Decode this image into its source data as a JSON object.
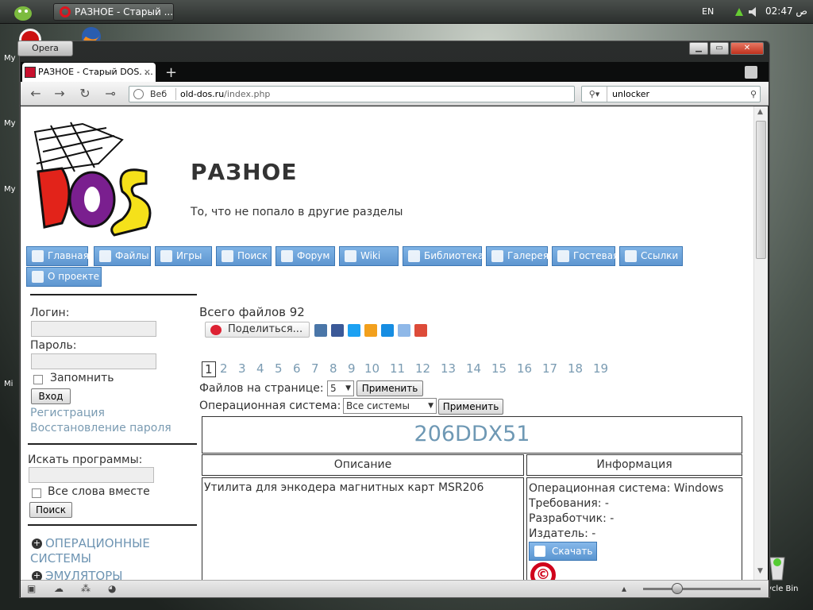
{
  "taskbar": {
    "task_title": "РАЗНОЕ - Старый ...",
    "lang": "EN",
    "time": "02:47",
    "ampm": "ص"
  },
  "desktop": {
    "labels": [
      "My",
      "My",
      "My",
      "Mi"
    ],
    "recycle": "ycle Bin"
  },
  "opera": {
    "menu_label": "Opera",
    "tab_title": "РАЗНОЕ - Старый DOS. ...",
    "tab_close": "×",
    "new_tab": "+",
    "url_prefix": "Веб",
    "url_domain": "old-dos.ru",
    "url_path": "/index.php",
    "search_text": "unlocker"
  },
  "site": {
    "title": "РАЗНОЕ",
    "subtitle": "То, что не попало в другие разделы",
    "menu": [
      "Главная",
      "Файлы",
      "Игры",
      "Поиск",
      "Форум",
      "Wiki",
      "Библиотека",
      "Галерея",
      "Гостевая",
      "Ссылки",
      "О проекте"
    ]
  },
  "sidebar": {
    "login_label": "Логин:",
    "password_label": "Пароль:",
    "remember_label": "Запомнить",
    "login_button": "Вход",
    "register_link": "Регистрация",
    "restore_link": "Восстановление пароля",
    "search_label": "Искать программы:",
    "all_words_label": "Все слова вместе",
    "search_button": "Поиск",
    "categories": [
      "ОПЕРАЦИОННЫЕ",
      "СИСТЕМЫ",
      "ЭМУЛЯТОРЫ"
    ]
  },
  "content": {
    "total": "Всего файлов 92",
    "share": "Поделиться...",
    "pages": [
      "1",
      "2",
      "3",
      "4",
      "5",
      "6",
      "7",
      "8",
      "9",
      "10",
      "11",
      "12",
      "13",
      "14",
      "15",
      "16",
      "17",
      "18",
      "19"
    ],
    "per_page_label": "Файлов на странице:",
    "per_page_value": "5",
    "apply": "Применить",
    "os_label": "Операционная система:",
    "os_value": "Все системы",
    "program_name": "206DDX51",
    "col_desc": "Описание",
    "col_info": "Информация",
    "description": "Утилита для энкодера магнитных карт MSR206",
    "info": [
      "Операционная система: Windows",
      "Требования: -",
      "Разработчик: -",
      "Издатель: -"
    ],
    "download": "Скачать",
    "copyright_symbol": "©"
  }
}
